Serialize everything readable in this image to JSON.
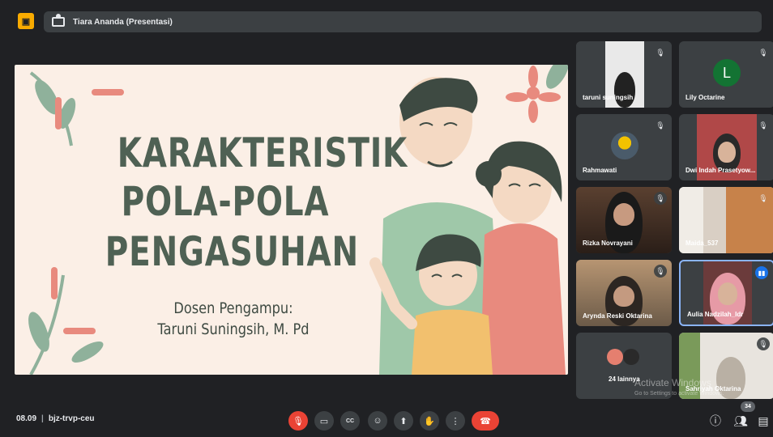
{
  "app": {
    "badge_icon": "meet-presentation-badge-icon",
    "accent": "#f9ab00"
  },
  "presenter_bar": {
    "name": "Tiara Ananda (Presentasi)",
    "icon": "presentation-icon"
  },
  "slide": {
    "title_lines": [
      "KARAKTERISTIK",
      "POLA-POLA",
      "PENGASUHAN"
    ],
    "subtitle_label": "Dosen Pengampu:",
    "lecturer": "Taruni Suningsih, M. Pd",
    "background": "#fbefe6",
    "title_color": "#4f6154"
  },
  "participants": [
    {
      "name": "taruni suningsih",
      "muted": true,
      "kind": "video"
    },
    {
      "name": "Lily Octarine",
      "muted": true,
      "kind": "letter",
      "letter": "L",
      "avatar_color": "#137333"
    },
    {
      "name": "Rahmawati",
      "muted": true,
      "kind": "photo-avatar"
    },
    {
      "name": "Dwi Indah Prasetyow...",
      "muted": true,
      "kind": "video"
    },
    {
      "name": "Rizka Novrayani",
      "muted": true,
      "kind": "video"
    },
    {
      "name": "Maida_537",
      "muted": true,
      "kind": "video"
    },
    {
      "name": "Arynda Reski Oktarina",
      "muted": true,
      "kind": "video"
    },
    {
      "name": "Aulia Nadzilah_Idr",
      "muted": false,
      "speaking": true,
      "kind": "video"
    },
    {
      "name": "24 lainnya",
      "muted": false,
      "kind": "others"
    },
    {
      "name": "Sahriyah Oktarina",
      "muted": true,
      "kind": "video"
    }
  ],
  "bottom_bar": {
    "time": "08.09",
    "meeting_code": "bjz-trvp-ceu",
    "controls": [
      {
        "name": "mic-off-icon",
        "glyph": "🎙",
        "red": true
      },
      {
        "name": "camera-icon",
        "glyph": "▭"
      },
      {
        "name": "captions-icon",
        "glyph": "CC"
      },
      {
        "name": "emoji-icon",
        "glyph": "☺"
      },
      {
        "name": "present-icon",
        "glyph": "⬆"
      },
      {
        "name": "raise-hand-icon",
        "glyph": "✋"
      },
      {
        "name": "more-options-icon",
        "glyph": "⋮"
      }
    ],
    "end_call_icon": "end-call-icon",
    "participant_count": "34"
  },
  "watermark": {
    "line1": "Activate Windows",
    "line2": "Go to Settings to activate Windows."
  }
}
